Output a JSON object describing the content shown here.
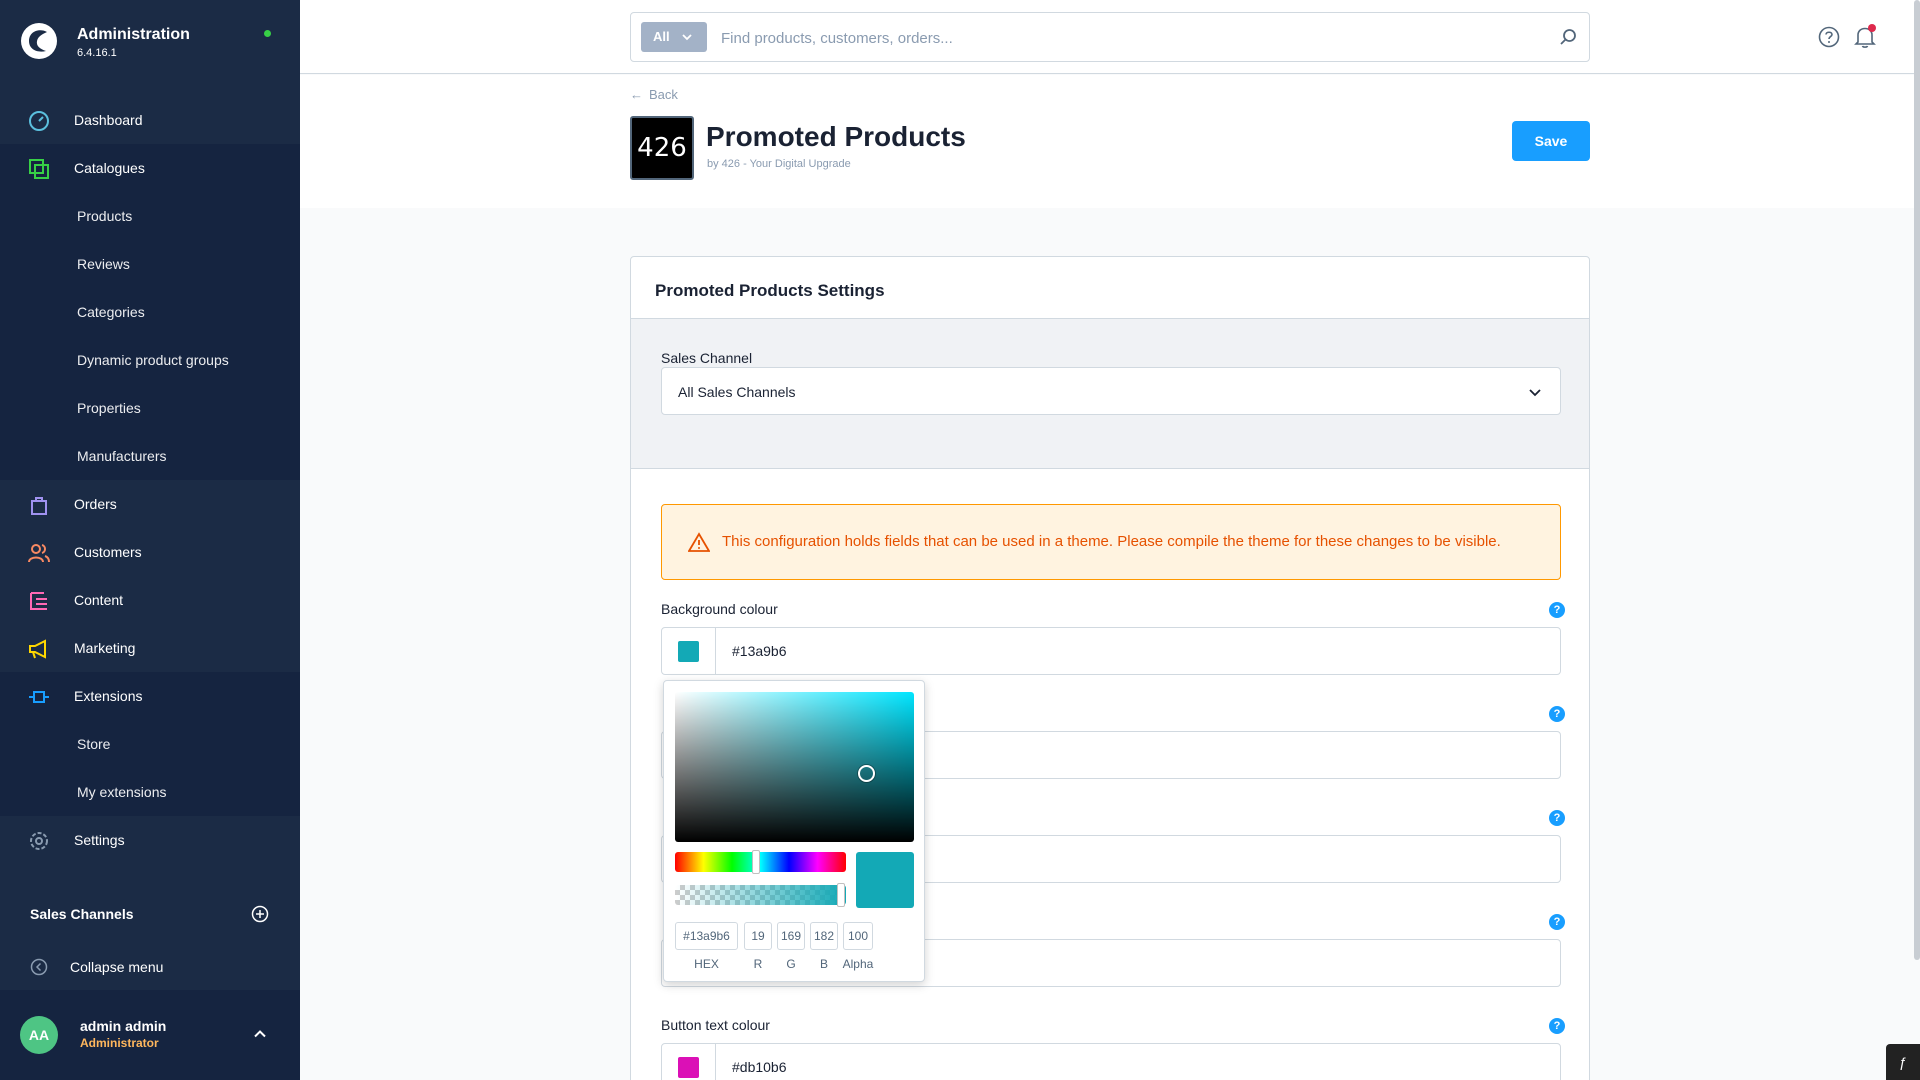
{
  "app": {
    "title": "Administration",
    "version": "6.4.16.1",
    "status_color": "#37d046"
  },
  "sidebar": {
    "items": [
      {
        "label": "Dashboard",
        "icon": "dashboard-icon"
      },
      {
        "label": "Catalogues",
        "icon": "catalogues-icon"
      },
      {
        "label": "Orders",
        "icon": "orders-icon"
      },
      {
        "label": "Customers",
        "icon": "customers-icon"
      },
      {
        "label": "Content",
        "icon": "content-icon"
      },
      {
        "label": "Marketing",
        "icon": "marketing-icon"
      },
      {
        "label": "Extensions",
        "icon": "extensions-icon"
      },
      {
        "label": "Settings",
        "icon": "settings-icon"
      }
    ],
    "catalogue_sub": [
      "Products",
      "Reviews",
      "Categories",
      "Dynamic product groups",
      "Properties",
      "Manufacturers"
    ],
    "extension_sub": [
      "Store",
      "My extensions"
    ],
    "sales_channels_label": "Sales Channels",
    "collapse_label": "Collapse menu",
    "user": {
      "initials": "AA",
      "name": "admin admin",
      "role": "Administrator"
    }
  },
  "search": {
    "type_label": "All",
    "placeholder": "Find products, customers, orders..."
  },
  "page": {
    "back_label": "Back",
    "logo_text": "426",
    "title": "Promoted Products",
    "by_line": "by 426 - Your Digital Upgrade",
    "save_label": "Save"
  },
  "card": {
    "title": "Promoted Products Settings",
    "sales_channel_label": "Sales Channel",
    "sales_channel_value": "All Sales Channels",
    "warning": "This configuration holds fields that can be used in a theme. Please compile the theme for these changes to be visible.",
    "fields": [
      {
        "label": "Background colour",
        "value": "#13a9b6",
        "color": "#13a9b6"
      },
      {
        "label": "Button text colour",
        "value": "#db10b6",
        "color": "#db10b6"
      }
    ]
  },
  "picker": {
    "hex": "#13a9b6",
    "r": "19",
    "g": "169",
    "b": "182",
    "alpha": "100",
    "labels": {
      "hex": "HEX",
      "r": "R",
      "g": "G",
      "b": "B",
      "alpha": "Alpha"
    },
    "color": "#13a9b6"
  }
}
